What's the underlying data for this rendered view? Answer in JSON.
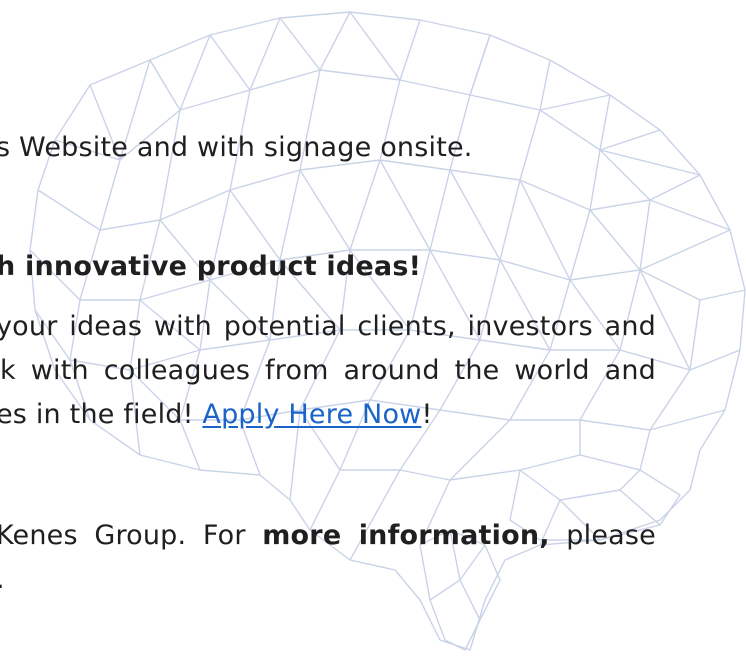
{
  "section_signage": {
    "line": "s Website and with signage onsite."
  },
  "section_product": {
    "heading": "h innovative product ideas!",
    "line1": " your ideas with potential clients, investors and",
    "line2": "k with colleagues from around the world and",
    "line3_before_link": "es in the field! ",
    "link_text": "Apply Here Now",
    "line3_after_link": "!"
  },
  "section_info": {
    "line1_prefix": " Kenes  Group.  For ",
    "line1_bold": "more  information,",
    "line1_suffix": " please",
    "line2": "."
  },
  "colors": {
    "text": "#1f1f1f",
    "link": "#1a63c9",
    "mesh": "#c7d1e6"
  },
  "icons": {
    "background": "brain-mesh-icon"
  }
}
